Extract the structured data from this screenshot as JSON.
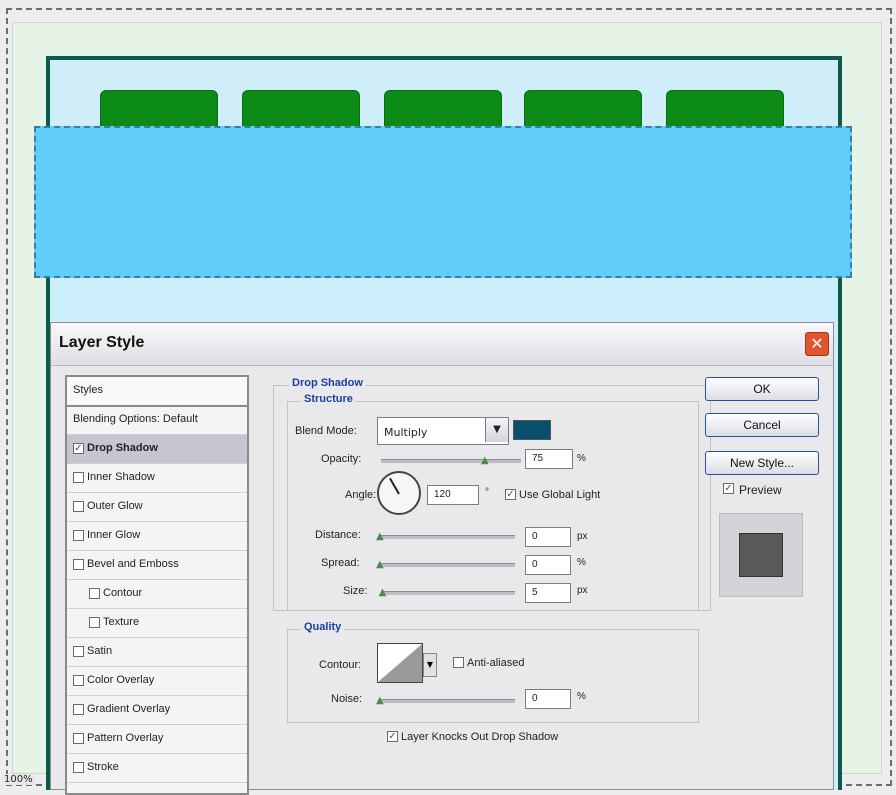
{
  "status": {
    "zoom": "100%"
  },
  "canvas": {
    "tabs": [
      "",
      "",
      "",
      "",
      ""
    ]
  },
  "dialog": {
    "title": "Layer Style",
    "styles_list": [
      {
        "label": "Styles",
        "checkbox": false,
        "checked": false,
        "selected": false,
        "indent": 0
      },
      {
        "label": "Blending Options: Default",
        "checkbox": false,
        "checked": false,
        "selected": false,
        "indent": 0
      },
      {
        "label": "Drop Shadow",
        "checkbox": true,
        "checked": true,
        "selected": true,
        "indent": 0
      },
      {
        "label": "Inner Shadow",
        "checkbox": true,
        "checked": false,
        "selected": false,
        "indent": 0
      },
      {
        "label": "Outer Glow",
        "checkbox": true,
        "checked": false,
        "selected": false,
        "indent": 0
      },
      {
        "label": "Inner Glow",
        "checkbox": true,
        "checked": false,
        "selected": false,
        "indent": 0
      },
      {
        "label": "Bevel and Emboss",
        "checkbox": true,
        "checked": false,
        "selected": false,
        "indent": 0
      },
      {
        "label": "Contour",
        "checkbox": true,
        "checked": false,
        "selected": false,
        "indent": 1
      },
      {
        "label": "Texture",
        "checkbox": true,
        "checked": false,
        "selected": false,
        "indent": 1
      },
      {
        "label": "Satin",
        "checkbox": true,
        "checked": false,
        "selected": false,
        "indent": 0
      },
      {
        "label": "Color Overlay",
        "checkbox": true,
        "checked": false,
        "selected": false,
        "indent": 0
      },
      {
        "label": "Gradient Overlay",
        "checkbox": true,
        "checked": false,
        "selected": false,
        "indent": 0
      },
      {
        "label": "Pattern Overlay",
        "checkbox": true,
        "checked": false,
        "selected": false,
        "indent": 0
      },
      {
        "label": "Stroke",
        "checkbox": true,
        "checked": false,
        "selected": false,
        "indent": 0
      }
    ],
    "drop_shadow": {
      "group_title": "Drop Shadow",
      "structure": {
        "title": "Structure",
        "blend_mode_label": "Blend Mode:",
        "blend_mode_value": "Multiply",
        "shadow_color": "#0b4f6e",
        "opacity_label": "Opacity:",
        "opacity_value": "75",
        "opacity_unit": "%",
        "opacity_level": 0.75,
        "angle_label": "Angle:",
        "angle_value": "120",
        "angle_unit": "°",
        "use_global_light_label": "Use Global Light",
        "use_global_light_checked": true,
        "distance_label": "Distance:",
        "distance_value": "0",
        "distance_unit": "px",
        "distance_level": 0,
        "spread_label": "Spread:",
        "spread_value": "0",
        "spread_unit": "%",
        "spread_level": 0,
        "size_label": "Size:",
        "size_value": "5",
        "size_unit": "px",
        "size_level": 0.02
      },
      "quality": {
        "title": "Quality",
        "contour_label": "Contour:",
        "anti_aliased_label": "Anti-aliased",
        "anti_aliased_checked": false,
        "noise_label": "Noise:",
        "noise_value": "0",
        "noise_unit": "%",
        "noise_level": 0
      },
      "layer_knocks_out_label": "Layer Knocks Out Drop Shadow",
      "layer_knocks_out_checked": true
    },
    "buttons": {
      "ok": "OK",
      "cancel": "Cancel",
      "new_style": "New Style..."
    },
    "preview_label": "Preview",
    "preview_checked": true
  }
}
